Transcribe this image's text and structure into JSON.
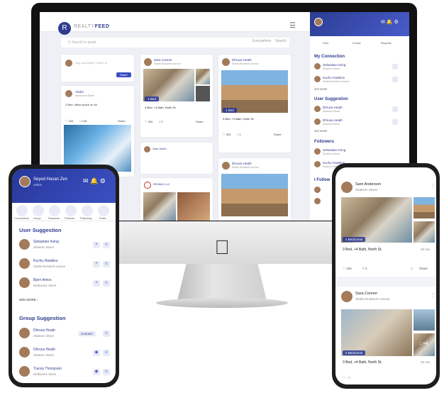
{
  "desktop": {
    "brand_prefix": "REALTY",
    "brand_suffix": "FEED",
    "search_placeholder": "Search in posts",
    "search_scope": "Everywhere",
    "search_button": "Search",
    "composer_placeholder": "Say something? Share it!",
    "composer_button": "Share",
    "post1": {
      "user": "Abdul",
      "sub": "Melbourne Street",
      "text": "2 Bed, office space on sit",
      "more": "",
      "likes": "326",
      "comments": "148",
      "share": "Share"
    },
    "post2": {
      "user": "Sara Conner",
      "sub": "Shafia Rustareh Avenue",
      "badge": "1 Bed",
      "title": "3 Bed, +4 Bath, North St.",
      "likes": "326",
      "comments": "2",
      "share": "Share"
    },
    "post3": {
      "user": "Dhruva Heath",
      "sub": "Shafia Rustareh Avenue",
      "badge": "1 Bed",
      "title": "3 Bed, +4 Bath, North St.",
      "likes": "326",
      "comments": "1",
      "share": "Share"
    },
    "post4": {
      "user": "Dhruva Heath",
      "sub": "Shafia Rustareh Avenue"
    },
    "comment_user": "Sam Smith",
    "remax_name": "RE/MAX LLC",
    "sidebar": {
      "tabs": [
        "Feed",
        "Groups",
        "Requests"
      ],
      "my_connection_title": "My Connection",
      "connections": [
        {
          "name": "Sebastian Irving",
          "sub": "Shakeen Street"
        },
        {
          "name": "Kuchu Hawkins",
          "sub": "Shafia Rustareh Avenue"
        }
      ],
      "see_more": "SEE MORE",
      "user_suggestion_title": "User Suggestion",
      "suggestions": [
        {
          "name": "Dhruva Heath",
          "sub": "Shakeen Street"
        },
        {
          "name": "Dhruva Heath",
          "sub": "Shakeen Street"
        }
      ],
      "followers_title": "Followers",
      "followers": [
        {
          "name": "Sebastian Irving",
          "sub": "Shakeen Street"
        },
        {
          "name": "Kuchu Hawkins",
          "sub": "Shakeen Street"
        }
      ],
      "follow_title": "I Follow"
    }
  },
  "left_phone": {
    "user_name": "Seyed Hasan Zen",
    "user_status": "online",
    "tabs": [
      "Connections",
      "Group",
      "Requests",
      "Follower",
      "Following",
      "Posts"
    ],
    "user_suggestion_title": "User Suggestion",
    "users": [
      {
        "name": "Sebastian Irving",
        "sub": "Shakeen Street"
      },
      {
        "name": "Kuchu Hawkins",
        "sub": "Shafia Rustareh Avenue"
      },
      {
        "name": "Bjorn Amos",
        "sub": "Melbourne Street"
      }
    ],
    "see_more": "SEE MORE",
    "group_suggestion_title": "Group Suggestion",
    "groups": [
      {
        "name": "Dhruva Heath",
        "sub": "Shakeen Street",
        "action": "Connect"
      },
      {
        "name": "Dhruva Heath",
        "sub": "Shakeen Street"
      },
      {
        "name": "Tracey Thompson",
        "sub": "Melbourne Street"
      }
    ]
  },
  "right_phone": {
    "post1": {
      "user": "Sam Anderson",
      "sub": "Shakeen Street",
      "badge": "4 Bedrooms",
      "title": "3 Bed, +4 Bath, North St.",
      "time": "25 min",
      "likes": "326",
      "comments": "2",
      "share": "Share"
    },
    "post2": {
      "user": "Sara Conner",
      "sub": "Shafia Rustareh Avenue",
      "badge": "4 Bedrooms",
      "more_badge": "+4",
      "title": "3 Bed, +4 Bath, North St.",
      "time": "25 min"
    }
  },
  "colors": {
    "primary": "#2f3c8f",
    "header_gradient_start": "#27389a",
    "header_gradient_end": "#3c50c4"
  }
}
